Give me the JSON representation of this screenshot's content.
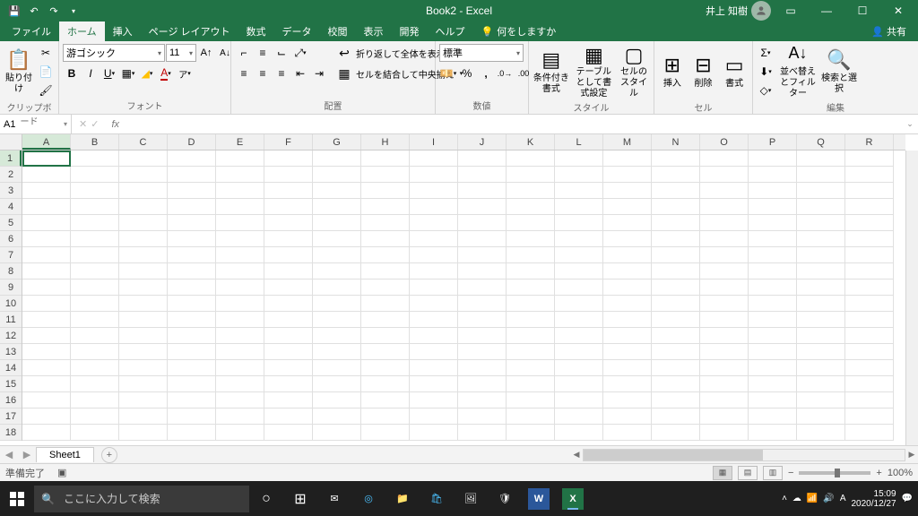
{
  "title": "Book2 - Excel",
  "user": "井上 知樹",
  "tabs": {
    "file": "ファイル",
    "home": "ホーム",
    "insert": "挿入",
    "layout": "ページ レイアウト",
    "formulas": "数式",
    "data": "データ",
    "review": "校閲",
    "view": "表示",
    "dev": "開発",
    "help": "ヘルプ",
    "tellme": "何をしますか",
    "share": "共有"
  },
  "ribbon": {
    "clipboard": {
      "label": "クリップボード",
      "paste": "貼り付け"
    },
    "font": {
      "label": "フォント",
      "name": "游ゴシック",
      "size": "11"
    },
    "align": {
      "label": "配置",
      "wrap": "折り返して全体を表示する",
      "merge": "セルを結合して中央揃え"
    },
    "number": {
      "label": "数値",
      "format": "標準"
    },
    "styles": {
      "label": "スタイル",
      "cond": "条件付き書式",
      "table": "テーブルとして書式設定",
      "cell": "セルのスタイル"
    },
    "cells": {
      "label": "セル",
      "insert": "挿入",
      "delete": "削除",
      "format": "書式"
    },
    "editing": {
      "label": "編集",
      "sort": "並べ替えとフィルター",
      "find": "検索と選択"
    }
  },
  "namebox": "A1",
  "columns": [
    "A",
    "B",
    "C",
    "D",
    "E",
    "F",
    "G",
    "H",
    "I",
    "J",
    "K",
    "L",
    "M",
    "N",
    "O",
    "P",
    "Q",
    "R"
  ],
  "rows": [
    "1",
    "2",
    "3",
    "4",
    "5",
    "6",
    "7",
    "8",
    "9",
    "10",
    "11",
    "12",
    "13",
    "14",
    "15",
    "16",
    "17",
    "18"
  ],
  "sheet_tab": "Sheet1",
  "status": "準備完了",
  "zoom": "100%",
  "taskbar": {
    "search": "ここに入力して検索",
    "time": "15:09",
    "date": "2020/12/27"
  }
}
